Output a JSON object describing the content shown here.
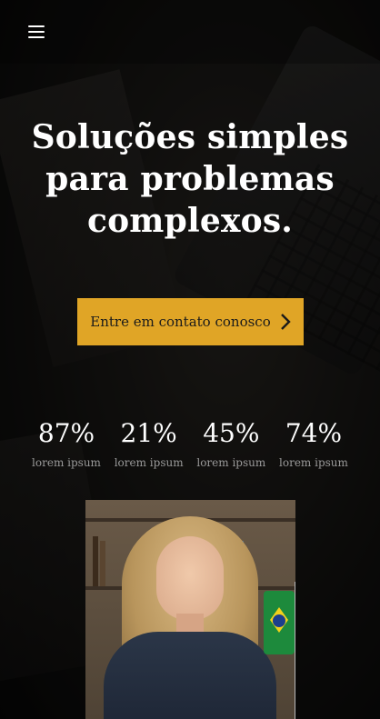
{
  "header": {
    "menu_icon": "hamburger-menu-icon"
  },
  "hero": {
    "headline_lines": [
      "Soluções simples",
      "para problemas",
      "complexos."
    ],
    "cta_label": "Entre em contato conosco",
    "cta_icon": "chevron-right-icon",
    "colors": {
      "accent": "#e0a526",
      "text": "#ffffff",
      "muted": "#9a9a9a"
    }
  },
  "stats": [
    {
      "value": "87%",
      "label": "lorem ipsum"
    },
    {
      "value": "21%",
      "label": "lorem ipsum"
    },
    {
      "value": "45%",
      "label": "lorem ipsum"
    },
    {
      "value": "74%",
      "label": "lorem ipsum"
    }
  ]
}
